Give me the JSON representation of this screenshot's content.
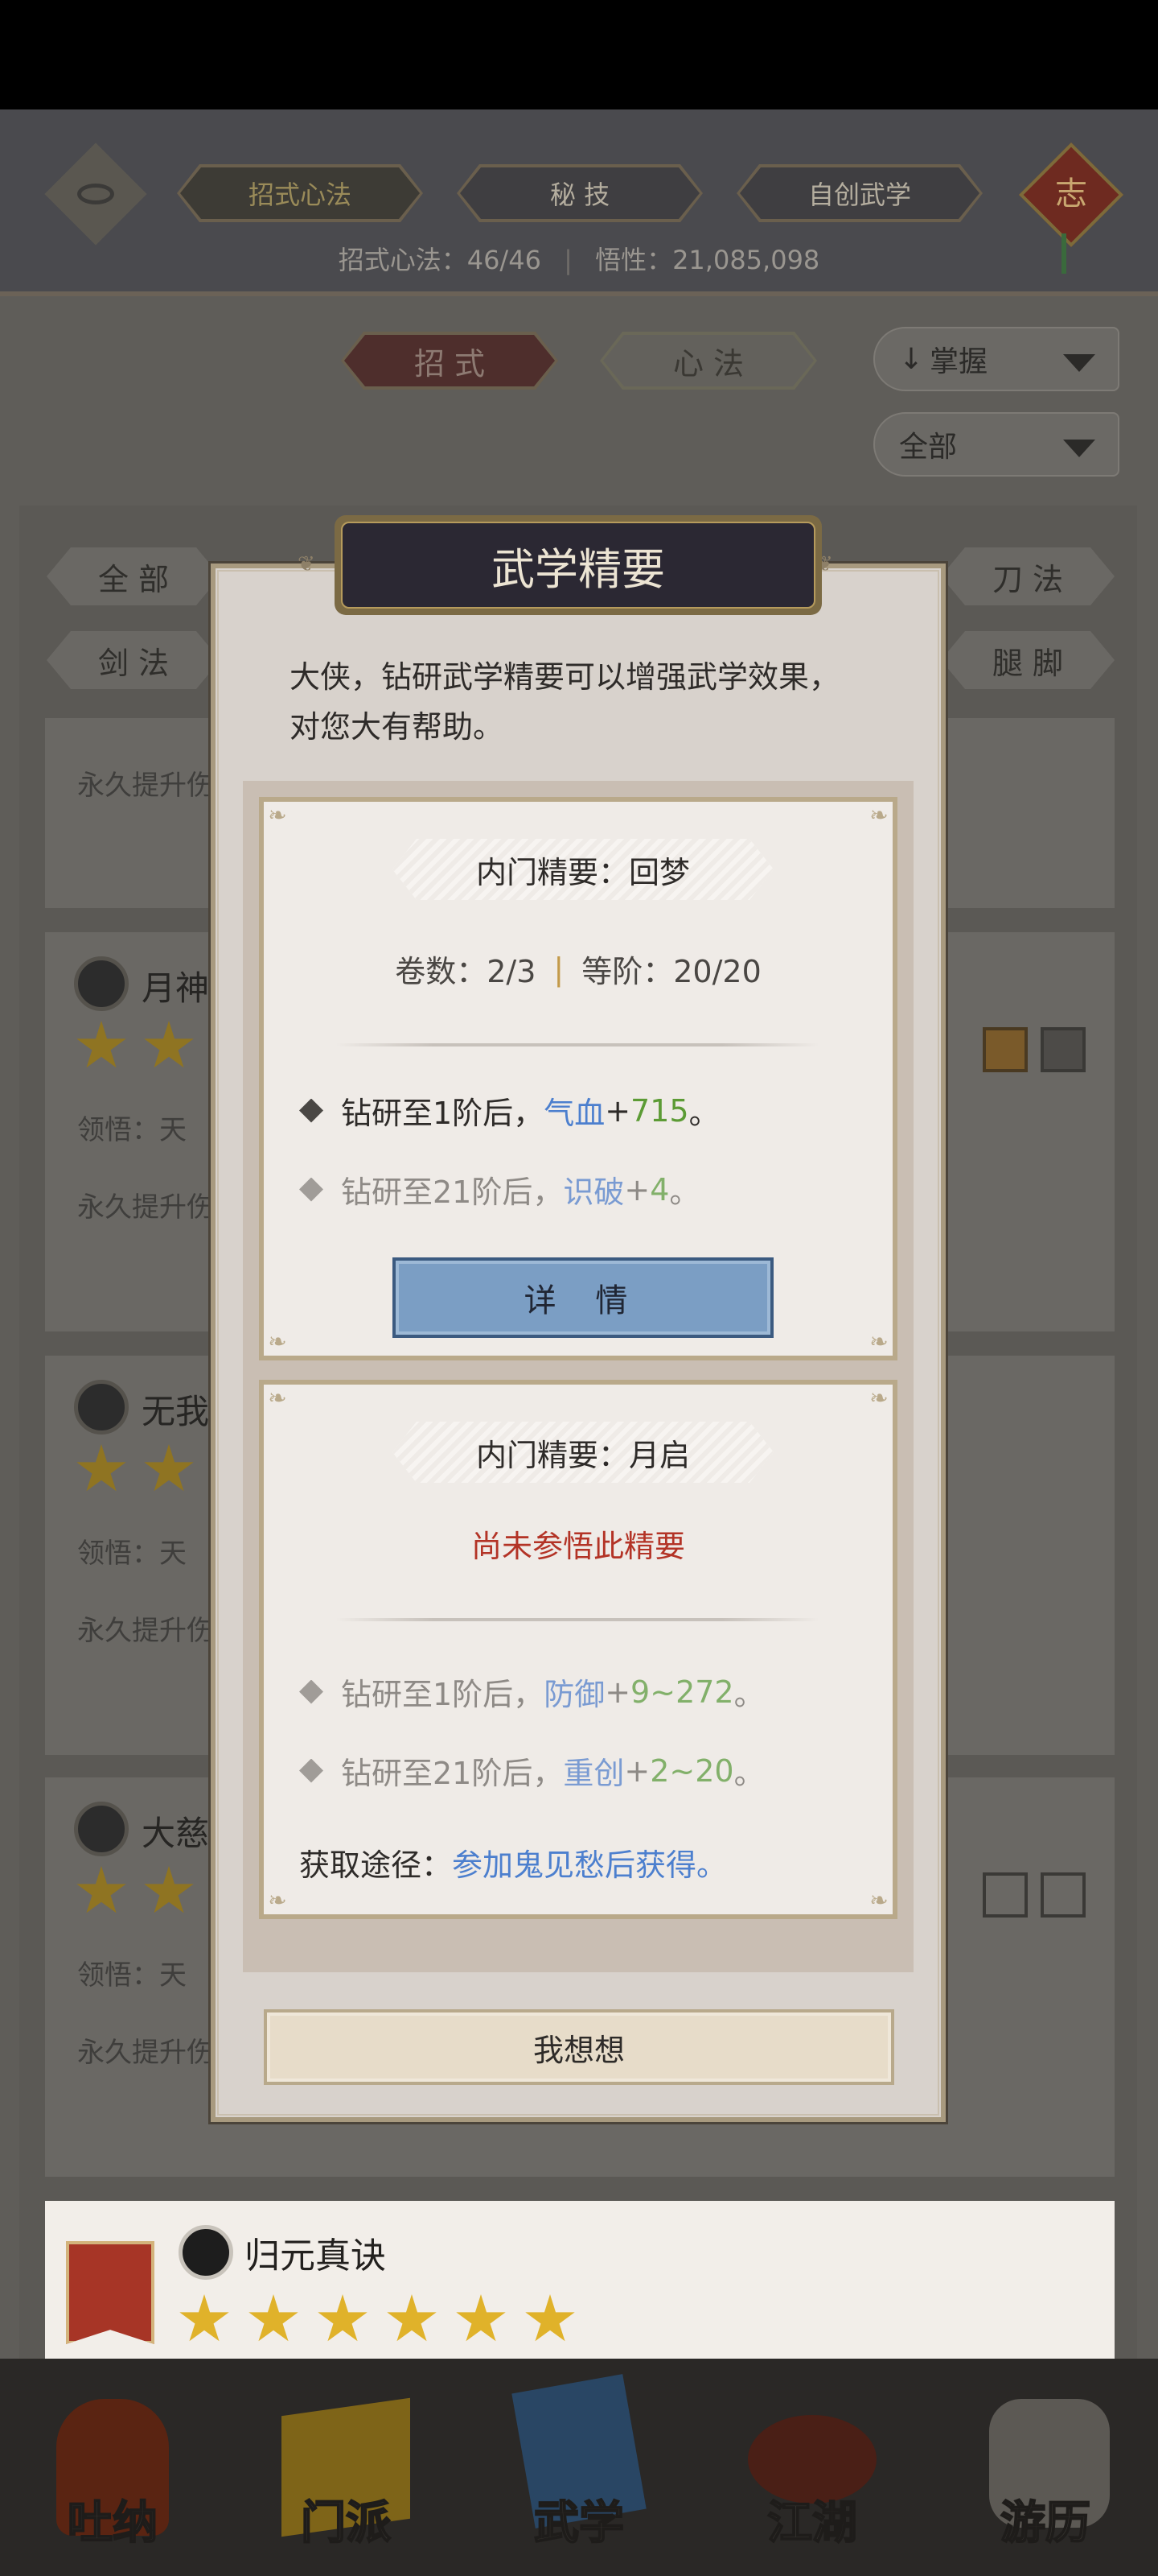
{
  "header": {
    "tabs": [
      {
        "label": "招式心法"
      },
      {
        "label": "秘 技"
      },
      {
        "label": "自创武学"
      }
    ],
    "seal_char": "志",
    "stats_text": "招式心法：46/46",
    "wuxing_text": "悟性：21,085,098"
  },
  "segment": {
    "zhaoshi": "招 式",
    "xinfa": "心 法"
  },
  "filters": {
    "sort_label": "掌握",
    "category_label": "全部"
  },
  "chips": [
    "全 部",
    "刀 法",
    "剑 法",
    "腿 脚"
  ],
  "cards": [
    {
      "snippet": "永久提升伤"
    },
    {
      "title": "月神",
      "grasp": "领悟：天",
      "snippet": "永久提升伤"
    },
    {
      "title": "无我",
      "grasp": "领悟：天",
      "snippet": "永久提升伤"
    },
    {
      "title": "大慈",
      "grasp": "领悟：天",
      "snippet": "永久提升伤"
    },
    {
      "title": "归元真诀"
    }
  ],
  "modal": {
    "title": "武学精要",
    "intro": "大侠，钻研武学精要可以增强武学效果，对您大有帮助。",
    "section1": {
      "ribbon": "内门精要：回梦",
      "volumes": "卷数：2/3",
      "rank": "等阶：20/20",
      "line1": {
        "prefix": "钻研至1阶后，",
        "attr": "气血",
        "op": " + ",
        "value": "715",
        "suffix": "。"
      },
      "line2": {
        "prefix": "钻研至21阶后，",
        "attr": "识破",
        "op": " + ",
        "value": "4",
        "suffix": "。"
      },
      "detail_button": "详 情"
    },
    "section2": {
      "ribbon": "内门精要：月启",
      "status": "尚未参悟此精要",
      "line1": {
        "prefix": "钻研至1阶后，",
        "attr": "防御",
        "op": " + ",
        "value": "9~272",
        "suffix": "。"
      },
      "line2": {
        "prefix": "钻研至21阶后，",
        "attr": "重创",
        "op": " + ",
        "value": "2~20",
        "suffix": "。"
      },
      "source_label": "获取途径：",
      "source_text": "参加鬼见愁后获得。"
    },
    "think_button": "我想想"
  },
  "nav": [
    {
      "label": "吐纳",
      "icon": "meditation-figure-icon",
      "color": "#6b2a12"
    },
    {
      "label": "门派",
      "icon": "sect-banner-icon",
      "color": "#8a6a1a"
    },
    {
      "label": "武学",
      "icon": "martial-books-icon",
      "color": "#2a4a6a"
    },
    {
      "label": "江湖",
      "icon": "bamboo-hat-icon",
      "color": "#5a2418"
    },
    {
      "label": "游历",
      "icon": "white-horse-icon",
      "color": "#6a6660"
    }
  ]
}
